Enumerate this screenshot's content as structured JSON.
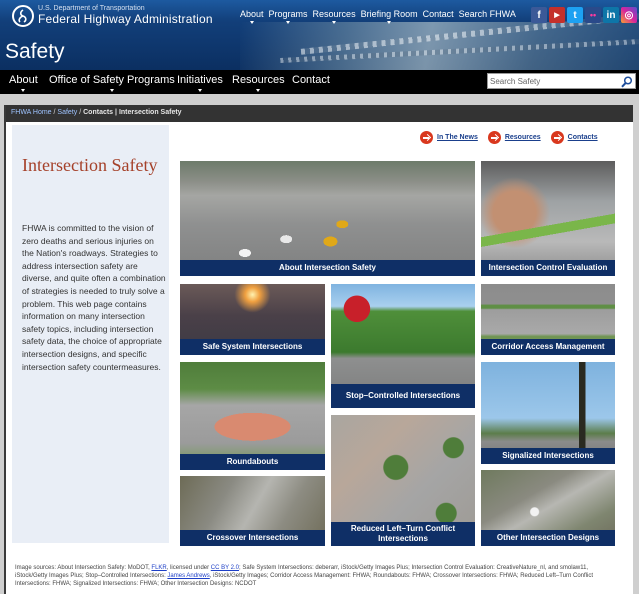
{
  "header": {
    "agency_line1": "U.S. Department of Transportation",
    "agency_line2": "Federal Highway Administration",
    "section_title": "Safety",
    "top_nav": [
      {
        "label": "About",
        "has_menu": true
      },
      {
        "label": "Programs",
        "has_menu": true
      },
      {
        "label": "Resources",
        "has_menu": true
      },
      {
        "label": "Briefing Room",
        "has_menu": true
      },
      {
        "label": "Contact",
        "has_menu": false
      },
      {
        "label": "Search FHWA",
        "has_menu": false
      }
    ],
    "social": [
      {
        "name": "facebook",
        "glyph": "f",
        "color": "#3b5998"
      },
      {
        "name": "youtube",
        "glyph": "▶",
        "color": "#c4302b"
      },
      {
        "name": "twitter",
        "glyph": "t",
        "color": "#1da1f2"
      },
      {
        "name": "flickr",
        "glyph": "••",
        "color": "#2a4a8a"
      },
      {
        "name": "linkedin",
        "glyph": "in",
        "color": "#0e76a8"
      },
      {
        "name": "instagram",
        "glyph": "◎",
        "color": "#c13584"
      }
    ]
  },
  "section_nav": {
    "items": [
      {
        "label": "About",
        "has_menu": true
      },
      {
        "label": "Office of Safety Programs",
        "has_menu": true
      },
      {
        "label": "Initiatives",
        "has_menu": true
      },
      {
        "label": "Resources",
        "has_menu": true
      },
      {
        "label": "Contact",
        "has_menu": false
      }
    ],
    "search": {
      "placeholder": "Search Safety",
      "value": ""
    }
  },
  "breadcrumb": {
    "items": [
      "FHWA Home",
      "Safety",
      "Contacts"
    ],
    "current": "Intersection Safety"
  },
  "quick_links": [
    "In The News",
    "Resources",
    "Contacts"
  ],
  "sidebar": {
    "title": "Intersection Safety",
    "text": "FHWA is committed to the vision of zero deaths and serious injuries on the Nation's roadways. Strategies to address intersection safety are diverse, and quite often a combination of strategies is needed to truly solve a problem. This web page contains information on many intersection safety topics, including intersection safety data, the choice of appropriate intersection designs, and specific intersection safety countermeasures."
  },
  "tiles": [
    {
      "label": "About Intersection Safety"
    },
    {
      "label": "Intersection Control Evaluation"
    },
    {
      "label": "Safe System Intersections"
    },
    {
      "label": "Stop–Controlled Intersections"
    },
    {
      "label": "Corridor Access Management"
    },
    {
      "label": "Roundabouts"
    },
    {
      "label": "Signalized Intersections"
    },
    {
      "label": "Reduced Left–Turn Conflict Intersections"
    },
    {
      "label": "Crossover Intersections"
    },
    {
      "label": "Other Intersection Designs"
    }
  ],
  "credits": {
    "prefix": "Image sources: About Intersection Safety: MoDOT, ",
    "link1": "FLKR",
    "mid1": ", licensed under ",
    "link2": "CC BY 2.0",
    "mid2": "; Safe System Intersections: deberarr, iStock/Getty Images Plus; Intersection Control Evaluation: CreativeNature_nl, and smolaw11, iStock/Getty Images Plus; Stop–Controlled Intersections: ",
    "link3": "James Andrews",
    "suffix": ", iStock/Getty Images; Corridor Access Management: FHWA; Roundabouts: FHWA; Crossover Intersections: FHWA; Reduced Left–Turn Conflict Intersections: FHWA; Signalized Intersections: FHWA; Other Intersection Designs: NCDOT"
  }
}
